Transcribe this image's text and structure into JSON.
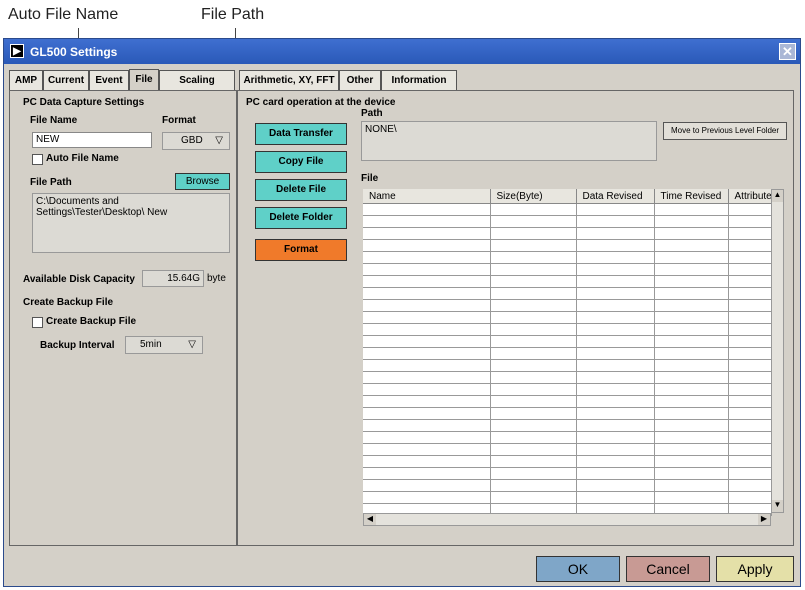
{
  "callouts": {
    "auto_file_name": "Auto File Name",
    "file_path": "File Path"
  },
  "window": {
    "title": "GL500 Settings"
  },
  "tabs": [
    {
      "label": "AMP"
    },
    {
      "label": "Current"
    },
    {
      "label": "Event"
    },
    {
      "label": "File"
    },
    {
      "label": "Scaling"
    },
    {
      "label": "Arithmetic, XY, FFT"
    },
    {
      "label": "Other"
    },
    {
      "label": "Information"
    }
  ],
  "left": {
    "section_title": "PC Data Capture Settings",
    "file_name_label": "File Name",
    "file_name_value": "NEW",
    "format_label": "Format",
    "format_value": "GBD",
    "auto_file_name_label": "Auto File Name",
    "file_path_label": "File Path",
    "browse_label": "Browse",
    "file_path_value": "C:\\Documents and Settings\\Tester\\Desktop\\ New",
    "disk_label": "Available Disk Capacity",
    "disk_value": "15.64G",
    "disk_unit": "byte",
    "backup_section": "Create Backup File",
    "backup_checkbox_label": "Create Backup File",
    "backup_interval_label": "Backup Interval",
    "backup_interval_value": "5min"
  },
  "right": {
    "section_title": "PC card operation at the device",
    "path_label": "Path",
    "path_value": "NONE\\",
    "move_up_label": "Move to Previous Level Folder",
    "file_label": "File",
    "buttons": {
      "data_transfer": "Data Transfer",
      "copy_file": "Copy File",
      "delete_file": "Delete File",
      "delete_folder": "Delete Folder",
      "format": "Format"
    },
    "columns": [
      "Name",
      "Size(Byte)",
      "Data Revised",
      "Time Revised",
      "Attribute"
    ]
  },
  "footer": {
    "ok": "OK",
    "cancel": "Cancel",
    "apply": "Apply"
  },
  "colors": {
    "teal_button": "#5fd0c8",
    "orange_button": "#f07a2a",
    "ok_button": "#7fa6c8",
    "cancel_button": "#c89a94",
    "apply_button": "#e4e0a8"
  }
}
